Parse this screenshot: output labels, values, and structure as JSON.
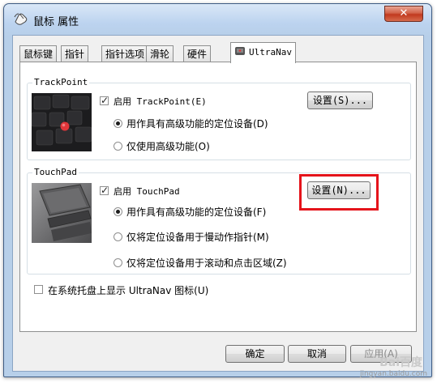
{
  "window": {
    "title": "鼠标 属性",
    "close_label": "✕"
  },
  "tabs": [
    {
      "label": "鼠标键",
      "active": false
    },
    {
      "label": "指针",
      "active": false
    },
    {
      "label": "指针选项",
      "active": false
    },
    {
      "label": "滑轮",
      "active": false
    },
    {
      "label": "硬件",
      "active": false
    },
    {
      "label": "UltraNav",
      "active": true
    }
  ],
  "trackpoint": {
    "group_title": "TrackPoint",
    "enable_label": "启用 TrackPoint(E)",
    "enable_checked": true,
    "settings_button": "设置(S)...",
    "options": [
      {
        "label": "用作具有高级功能的定位设备(D)",
        "checked": true
      },
      {
        "label": "仅使用高级功能(O)",
        "checked": false
      }
    ]
  },
  "touchpad": {
    "group_title": "TouchPad",
    "enable_label": "启用 TouchPad",
    "enable_checked": true,
    "settings_button": "设置(N)...",
    "options": [
      {
        "label": "用作具有高级功能的定位设备(F)",
        "checked": true
      },
      {
        "label": "仅将定位设备用于慢动作指针(M)",
        "checked": false
      },
      {
        "label": "仅将定位设备用于滚动和点击区域(Z)",
        "checked": false
      }
    ]
  },
  "tray_option": {
    "label": "在系统托盘上显示 UltraNav 图标(U)",
    "checked": false
  },
  "footer": {
    "ok": "确定",
    "cancel": "取消",
    "apply": "应用(A)"
  },
  "watermark": {
    "text": "jingyan.baidu.com",
    "logo": "Bai百度"
  },
  "colors": {
    "highlight": "#e5141b",
    "trackpoint_nub": "#e0363a"
  }
}
